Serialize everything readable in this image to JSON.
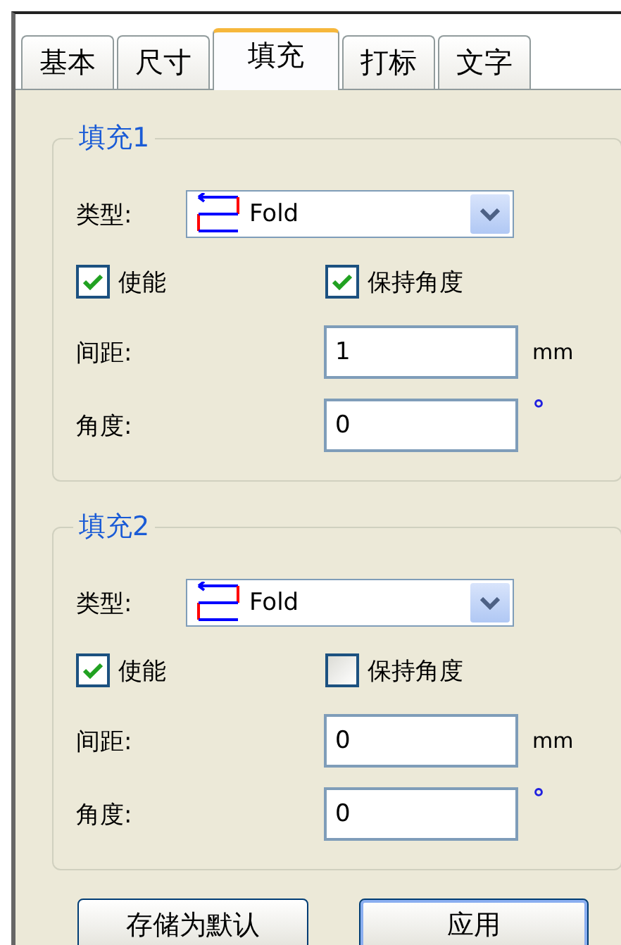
{
  "tabs": [
    {
      "label": "基本",
      "selected": false
    },
    {
      "label": "尺寸",
      "selected": false
    },
    {
      "label": "填充",
      "selected": true
    },
    {
      "label": "打标",
      "selected": false
    },
    {
      "label": "文字",
      "selected": false
    }
  ],
  "groups": [
    {
      "title": "填充1",
      "type_label": "类型:",
      "type_value": "Fold",
      "enable": {
        "label": "使能",
        "checked": true
      },
      "keep_angle": {
        "label": "保持角度",
        "checked": true
      },
      "spacing": {
        "label": "间距:",
        "value": "1",
        "unit": "mm"
      },
      "angle": {
        "label": "角度:",
        "value": "0",
        "unit": "°"
      }
    },
    {
      "title": "填充2",
      "type_label": "类型:",
      "type_value": "Fold",
      "enable": {
        "label": "使能",
        "checked": true
      },
      "keep_angle": {
        "label": "保持角度",
        "checked": false
      },
      "spacing": {
        "label": "间距:",
        "value": "0",
        "unit": "mm"
      },
      "angle": {
        "label": "角度:",
        "value": "0",
        "unit": "°"
      }
    }
  ],
  "buttons": [
    {
      "label": "存储为默认",
      "default": false
    },
    {
      "label": "应用",
      "default": true
    }
  ]
}
